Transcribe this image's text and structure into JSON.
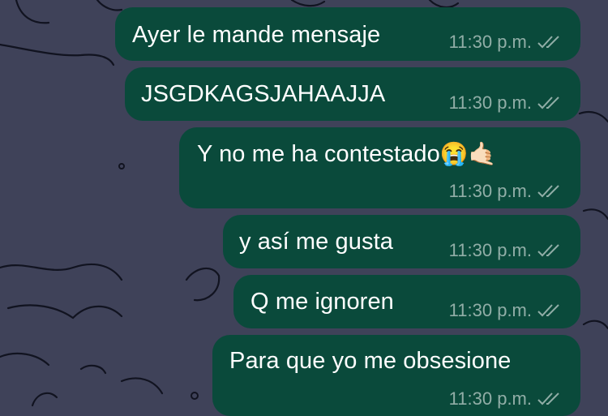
{
  "chat": {
    "messages": [
      {
        "text": "Ayer le mande mensaje",
        "time": "11:30 p.m.",
        "status": "double-check-read"
      },
      {
        "text": "JSGDKAGSJAHAAJJA",
        "time": "11:30 p.m.",
        "status": "double-check-read"
      },
      {
        "text": "Y no me ha contestado",
        "emoji": "😭🤙🏻",
        "time": "11:30 p.m.",
        "status": "double-check-read"
      },
      {
        "text": "y así me gusta",
        "time": "11:30 p.m.",
        "status": "double-check-read"
      },
      {
        "text": "Q me ignoren",
        "time": "11:30 p.m.",
        "status": "double-check-read"
      },
      {
        "text": "Para que yo me obsesione",
        "time": "11:30 p.m.",
        "status": "double-check-read"
      }
    ]
  },
  "colors": {
    "background": "#3f4259",
    "outgoing_bubble": "#0a4a3b",
    "text": "#ffffff"
  }
}
